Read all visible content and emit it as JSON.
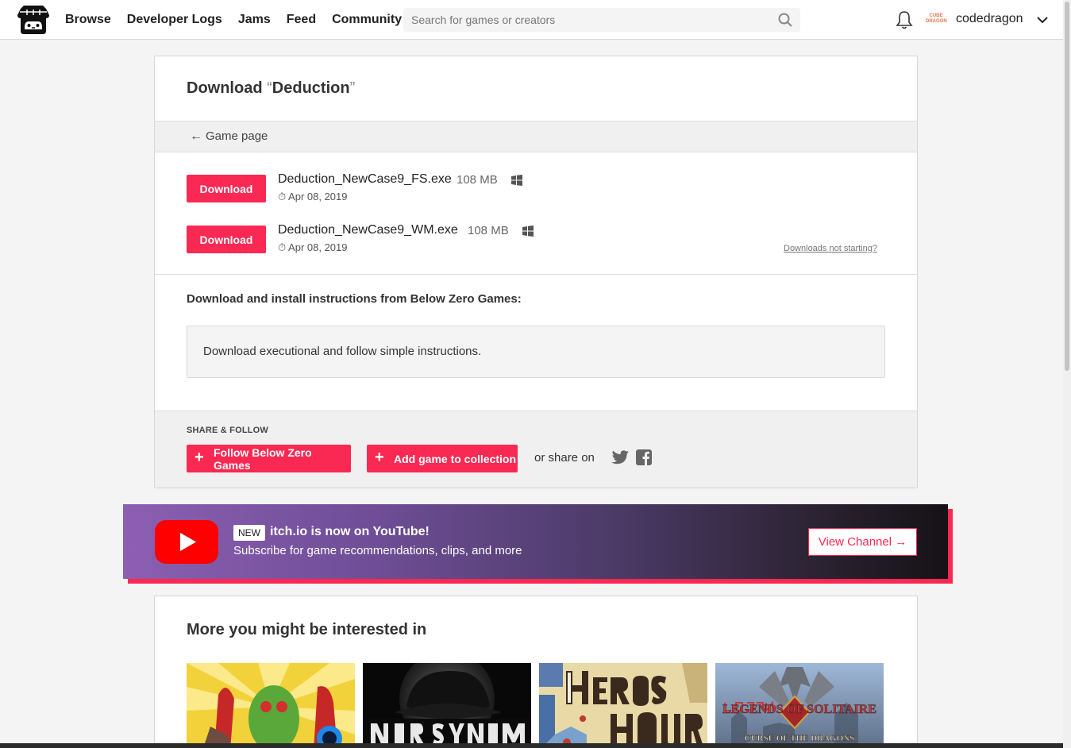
{
  "header": {
    "nav": [
      "Browse",
      "Developer Logs",
      "Jams",
      "Feed",
      "Community"
    ],
    "search_placeholder": "Search for games or creators",
    "username": "codedragon",
    "avatar_text": "CUBE\nDRAGON"
  },
  "download": {
    "title_prefix": "Download ",
    "open_quote": "“",
    "game_name": "Deduction",
    "close_quote": "”",
    "back_label": "Game page",
    "uploads": [
      {
        "button": "Download",
        "filename": "Deduction_NewCase9_FS.exe",
        "size": "108 MB",
        "date": "Apr 08, 2019",
        "platform": "windows-icon"
      },
      {
        "button": "Download",
        "filename": "Deduction_NewCase9_WM.exe",
        "size": "108 MB",
        "date": "Apr 08, 2019",
        "platform": "windows-icon"
      }
    ],
    "not_starting": "Downloads not starting?",
    "instructions_title": "Download and install instructions from Below Zero Games:",
    "instructions_text": "Download executional and follow simple instructions."
  },
  "share": {
    "label": "SHARE & FOLLOW",
    "follow_label": "Follow Below Zero Games",
    "collection_label": "Add game to collection",
    "share_on": "or share on"
  },
  "youtube": {
    "badge": "NEW",
    "title": "itch.io is now on YouTube!",
    "subtitle": "Subscribe for game recommendations, clips, and more",
    "button": "View Channel →"
  },
  "more": {
    "title": "More you might be interested in"
  },
  "colors": {
    "accent": "#fa2953",
    "text": "#222222"
  }
}
